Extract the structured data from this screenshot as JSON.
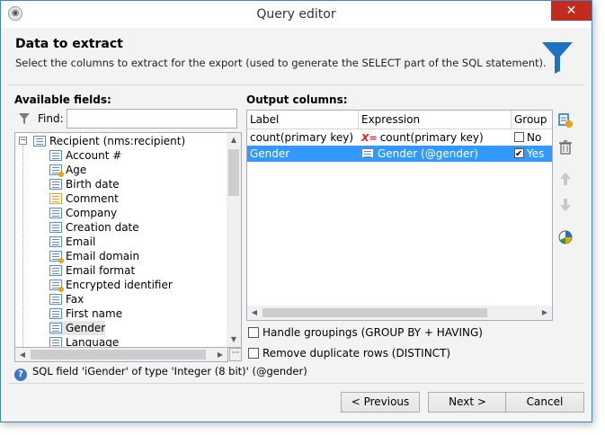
{
  "window": {
    "title": "Query editor"
  },
  "header": {
    "title": "Data to extract",
    "description": "Select the columns to extract for the export (used to generate the SELECT part of the SQL statement)."
  },
  "left_panel": {
    "label": "Available fields:",
    "find_label": "Find:",
    "find_value": "",
    "root": "Recipient (nms:recipient)",
    "fields": [
      {
        "label": "Account #",
        "icon": "list-field-icon"
      },
      {
        "label": "Age",
        "icon": "calculated-field-icon"
      },
      {
        "label": "Birth date",
        "icon": "list-field-icon"
      },
      {
        "label": "Comment",
        "icon": "memo-field-icon"
      },
      {
        "label": "Company",
        "icon": "list-field-icon"
      },
      {
        "label": "Creation date",
        "icon": "list-field-icon"
      },
      {
        "label": "Email",
        "icon": "list-field-icon"
      },
      {
        "label": "Email domain",
        "icon": "calculated-field-icon"
      },
      {
        "label": "Email format",
        "icon": "list-field-icon"
      },
      {
        "label": "Encrypted identifier",
        "icon": "calculated-field-icon"
      },
      {
        "label": "Fax",
        "icon": "list-field-icon"
      },
      {
        "label": "First name",
        "icon": "list-field-icon"
      },
      {
        "label": "Gender",
        "icon": "list-field-icon"
      },
      {
        "label": "Language",
        "icon": "list-field-icon"
      }
    ]
  },
  "right_panel": {
    "label": "Output columns:",
    "columns": [
      "Label",
      "Expression",
      "Group"
    ],
    "rows": [
      {
        "label": "count(primary key)",
        "expression": "count(primary key)",
        "group": "No",
        "checked": false,
        "selected": false
      },
      {
        "label": "Gender",
        "expression": "Gender (@gender)",
        "group": "Yes",
        "checked": true,
        "selected": true
      }
    ]
  },
  "options": {
    "groupings": "Handle groupings (GROUP BY + HAVING)",
    "distinct": "Remove duplicate rows (DISTINCT)"
  },
  "status": "SQL field 'iGender' of type 'Integer (8 bit)' (@gender)",
  "buttons": {
    "previous": "< Previous",
    "next": "Next >",
    "cancel": "Cancel"
  },
  "colors": {
    "selection": "#3399ff",
    "accent": "#1e73be",
    "close": "#c42b1c"
  }
}
